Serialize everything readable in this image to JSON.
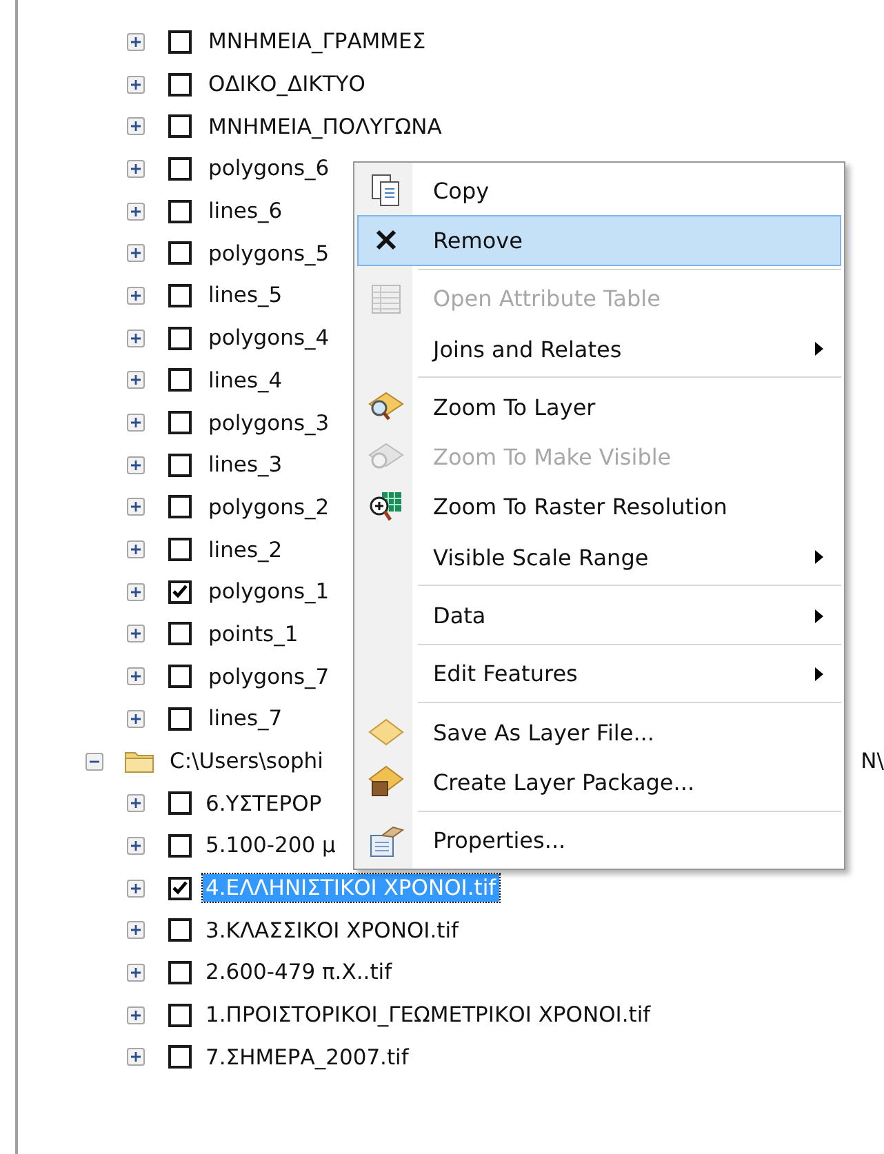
{
  "tree": {
    "layers": [
      {
        "label": "ΜΝΗΜΕΙΑ_ΓΡΑΜΜΕΣ",
        "expanded": false,
        "checked": false
      },
      {
        "label": "ΟΔΙΚΟ_ΔΙΚΤΥΟ",
        "expanded": false,
        "checked": false
      },
      {
        "label": "ΜΝΗΜΕΙΑ_ΠΟΛΥΓΩΝΑ",
        "expanded": false,
        "checked": false
      },
      {
        "label": "polygons_6",
        "expanded": false,
        "checked": false
      },
      {
        "label": "lines_6",
        "expanded": false,
        "checked": false
      },
      {
        "label": "polygons_5",
        "expanded": false,
        "checked": false
      },
      {
        "label": "lines_5",
        "expanded": false,
        "checked": false
      },
      {
        "label": "polygons_4",
        "expanded": false,
        "checked": false
      },
      {
        "label": "lines_4",
        "expanded": false,
        "checked": false
      },
      {
        "label": "polygons_3",
        "expanded": false,
        "checked": false
      },
      {
        "label": "lines_3",
        "expanded": false,
        "checked": false
      },
      {
        "label": "polygons_2",
        "expanded": false,
        "checked": false
      },
      {
        "label": "lines_2",
        "expanded": false,
        "checked": false
      },
      {
        "label": "polygons_1",
        "expanded": false,
        "checked": true
      },
      {
        "label": "points_1",
        "expanded": false,
        "checked": false
      },
      {
        "label": "polygons_7",
        "expanded": false,
        "checked": false
      },
      {
        "label": "lines_7",
        "expanded": false,
        "checked": false
      }
    ],
    "folder": {
      "label": "C:\\Users\\sophi",
      "label_tail": "N\\",
      "expanded": true,
      "children": [
        {
          "label": "6.ΥΣΤΕΡΟΡ",
          "expanded": false,
          "checked": false,
          "selected": false
        },
        {
          "label": "5.100-200 μ",
          "expanded": false,
          "checked": false,
          "selected": false
        },
        {
          "label": "4.ΕΛΛΗΝΙΣΤΙΚΟΙ ΧΡΟΝΟΙ.tif",
          "expanded": false,
          "checked": true,
          "selected": true
        },
        {
          "label": "3.ΚΛΑΣΣΙΚΟΙ ΧΡΟΝΟΙ.tif",
          "expanded": false,
          "checked": false,
          "selected": false
        },
        {
          "label": "2.600-479 π.Χ..tif",
          "expanded": false,
          "checked": false,
          "selected": false
        },
        {
          "label": "1.ΠΡΟΙΣΤΟΡΙΚΟΙ_ΓΕΩΜΕΤΡΙΚΟΙ ΧΡΟΝΟΙ.tif",
          "expanded": false,
          "checked": false,
          "selected": false
        },
        {
          "label": "7.ΣΗΜΕΡΑ_2007.tif",
          "expanded": false,
          "checked": false,
          "selected": false
        }
      ]
    }
  },
  "context_menu": {
    "items": [
      {
        "kind": "item",
        "label": "Copy",
        "disabled": false,
        "selected": false,
        "submenu": false
      },
      {
        "kind": "item",
        "label": "Remove",
        "disabled": false,
        "selected": true,
        "submenu": false
      },
      {
        "kind": "separator"
      },
      {
        "kind": "item",
        "label": "Open Attribute Table",
        "disabled": true,
        "selected": false,
        "submenu": false
      },
      {
        "kind": "item",
        "label": "Joins and Relates",
        "disabled": false,
        "selected": false,
        "submenu": true
      },
      {
        "kind": "separator"
      },
      {
        "kind": "item",
        "label": "Zoom To Layer",
        "disabled": false,
        "selected": false,
        "submenu": false
      },
      {
        "kind": "item",
        "label": "Zoom To Make Visible",
        "disabled": true,
        "selected": false,
        "submenu": false
      },
      {
        "kind": "item",
        "label": "Zoom To Raster Resolution",
        "disabled": false,
        "selected": false,
        "submenu": false
      },
      {
        "kind": "item",
        "label": "Visible Scale Range",
        "disabled": false,
        "selected": false,
        "submenu": true
      },
      {
        "kind": "separator"
      },
      {
        "kind": "item",
        "label": "Data",
        "disabled": false,
        "selected": false,
        "submenu": true
      },
      {
        "kind": "separator"
      },
      {
        "kind": "item",
        "label": "Edit Features",
        "disabled": false,
        "selected": false,
        "submenu": true
      },
      {
        "kind": "separator"
      },
      {
        "kind": "item",
        "label": "Save As Layer File...",
        "disabled": false,
        "selected": false,
        "submenu": false
      },
      {
        "kind": "item",
        "label": "Create Layer Package...",
        "disabled": false,
        "selected": false,
        "submenu": false
      },
      {
        "kind": "separator"
      },
      {
        "kind": "item",
        "label": "Properties...",
        "disabled": false,
        "selected": false,
        "submenu": false
      }
    ]
  }
}
